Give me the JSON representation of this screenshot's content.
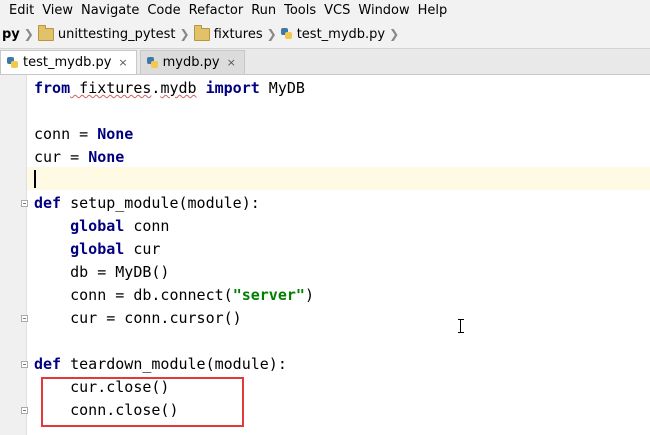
{
  "menu": [
    {
      "label": "Edit"
    },
    {
      "label": "View"
    },
    {
      "label": "Navigate"
    },
    {
      "label": "Code"
    },
    {
      "label": "Refactor"
    },
    {
      "label": "Run"
    },
    {
      "label": "Tools"
    },
    {
      "label": "VCS"
    },
    {
      "label": "Window"
    },
    {
      "label": "Help"
    }
  ],
  "breadcrumb": {
    "root": "py",
    "project": "unittesting_pytest",
    "folder": "fixtures",
    "file": "test_mydb.py"
  },
  "tabs": [
    {
      "label": "test_mydb.py",
      "close": "×",
      "active": true
    },
    {
      "label": "mydb.py",
      "close": "×",
      "active": false
    }
  ],
  "code": {
    "line1": {
      "kw_from": "from",
      "mod_a": " fixtures",
      "dot": ".",
      "mod_b": "mydb",
      "kw_import": " import",
      "rest": " MyDB"
    },
    "line3": {
      "text": "conn = ",
      "kw": "None"
    },
    "line4": {
      "text": "cur = ",
      "kw": "None"
    },
    "line6": {
      "kw": "def",
      "rest": " setup_module(module):"
    },
    "line7": {
      "indent": "    ",
      "kw": "global",
      "rest": " conn"
    },
    "line8": {
      "indent": "    ",
      "kw": "global",
      "rest": " cur"
    },
    "line9": {
      "text": "    db = MyDB()"
    },
    "line10": {
      "pre": "    conn = db.connect(",
      "str": "\"server\"",
      "post": ")"
    },
    "line11": {
      "text": "    cur = conn.cursor()"
    },
    "line13": {
      "kw": "def",
      "rest": " teardown_module(module):"
    },
    "line14": {
      "text": "    cur.close()"
    },
    "line15": {
      "text": "    conn.close()"
    }
  },
  "colors": {
    "keyword": "#000080",
    "string": "#008000",
    "highlight_box": "#e03a3a",
    "current_line": "#fffae3"
  }
}
